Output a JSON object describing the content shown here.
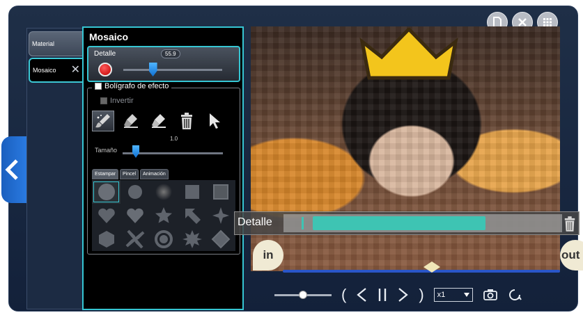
{
  "panel": {
    "title": "Mosaico"
  },
  "tabs": [
    {
      "label": "Material"
    },
    {
      "label": "Mosaico",
      "close": "✕"
    }
  ],
  "detail": {
    "label": "Detalle",
    "value": "55.9",
    "fraction": 0.3
  },
  "pen": {
    "checkbox_label": "Bolígrafo de efecto",
    "invert_label": "Invertir",
    "size_label": "Tamaño",
    "size_value": "1.0",
    "tools": [
      "brush-tool-icon",
      "eraser-tool-icon",
      "eraser-fill-icon",
      "trash-icon",
      "pointer-icon"
    ],
    "subtabs": [
      "Estampar",
      "Pincel",
      "Animación"
    ],
    "shapes": [
      "circle",
      "circle-medium",
      "circle-soft",
      "square",
      "square-soft",
      "heart",
      "heart-fill",
      "star",
      "arrow",
      "sparkle",
      "hexagon",
      "pinwheel",
      "ring",
      "burst",
      "octagon"
    ]
  },
  "overlay": {
    "detail_label": "Detalle"
  },
  "timeline": {
    "in_label": "in",
    "out_label": "out"
  },
  "player": {
    "speed": "x1"
  },
  "colors": {
    "accent": "#36c6d3",
    "fill": "#3ec4b3",
    "frame": "#1f2f47"
  }
}
